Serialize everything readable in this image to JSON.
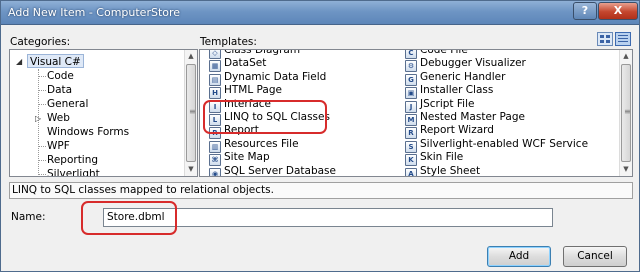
{
  "window": {
    "title": "Add New Item - ComputerStore",
    "help_label": "?",
    "close_label": "X"
  },
  "categories": {
    "label": "Categories:",
    "root": "Visual C#",
    "children": [
      "Code",
      "Data",
      "General",
      "Web",
      "Windows Forms",
      "WPF",
      "Reporting",
      "Silverlight"
    ]
  },
  "templates": {
    "label": "Templates:",
    "left_column": [
      {
        "name": "Class Diagram",
        "icon": "class-diagram-icon",
        "glyph": "◇"
      },
      {
        "name": "DataSet",
        "icon": "dataset-icon",
        "glyph": "▦"
      },
      {
        "name": "Dynamic Data Field",
        "icon": "dynamic-data-field-icon",
        "glyph": "▤"
      },
      {
        "name": "HTML Page",
        "icon": "html-page-icon",
        "glyph": "H"
      },
      {
        "name": "Interface",
        "icon": "interface-icon",
        "glyph": "I"
      },
      {
        "name": "LINQ to SQL Classes",
        "icon": "linq-to-sql-icon",
        "glyph": "L"
      },
      {
        "name": "Report",
        "icon": "report-icon",
        "glyph": "R"
      },
      {
        "name": "Resources File",
        "icon": "resources-file-icon",
        "glyph": "▥"
      },
      {
        "name": "Site Map",
        "icon": "site-map-icon",
        "glyph": "⌘"
      },
      {
        "name": "SQL Server Database",
        "icon": "sql-server-database-icon",
        "glyph": "◉"
      }
    ],
    "right_column": [
      {
        "name": "Code File",
        "icon": "code-file-icon",
        "glyph": "C"
      },
      {
        "name": "Debugger Visualizer",
        "icon": "debugger-visualizer-icon",
        "glyph": "⚙"
      },
      {
        "name": "Generic Handler",
        "icon": "generic-handler-icon",
        "glyph": "G"
      },
      {
        "name": "Installer Class",
        "icon": "installer-class-icon",
        "glyph": "▣"
      },
      {
        "name": "JScript File",
        "icon": "jscript-file-icon",
        "glyph": "J"
      },
      {
        "name": "Nested Master Page",
        "icon": "nested-master-page-icon",
        "glyph": "M"
      },
      {
        "name": "Report Wizard",
        "icon": "report-wizard-icon",
        "glyph": "R"
      },
      {
        "name": "Silverlight-enabled WCF Service",
        "icon": "wcf-service-icon",
        "glyph": "S"
      },
      {
        "name": "Skin File",
        "icon": "skin-file-icon",
        "glyph": "K"
      },
      {
        "name": "Style Sheet",
        "icon": "style-sheet-icon",
        "glyph": "A"
      }
    ]
  },
  "status_text": "LINQ to SQL classes mapped to relational objects.",
  "name_field": {
    "label": "Name:",
    "value": "Store.dbml"
  },
  "buttons": {
    "add": "Add",
    "cancel": "Cancel"
  },
  "colors": {
    "highlight": "#d72b2b",
    "title_bar": "#6e95c4"
  }
}
